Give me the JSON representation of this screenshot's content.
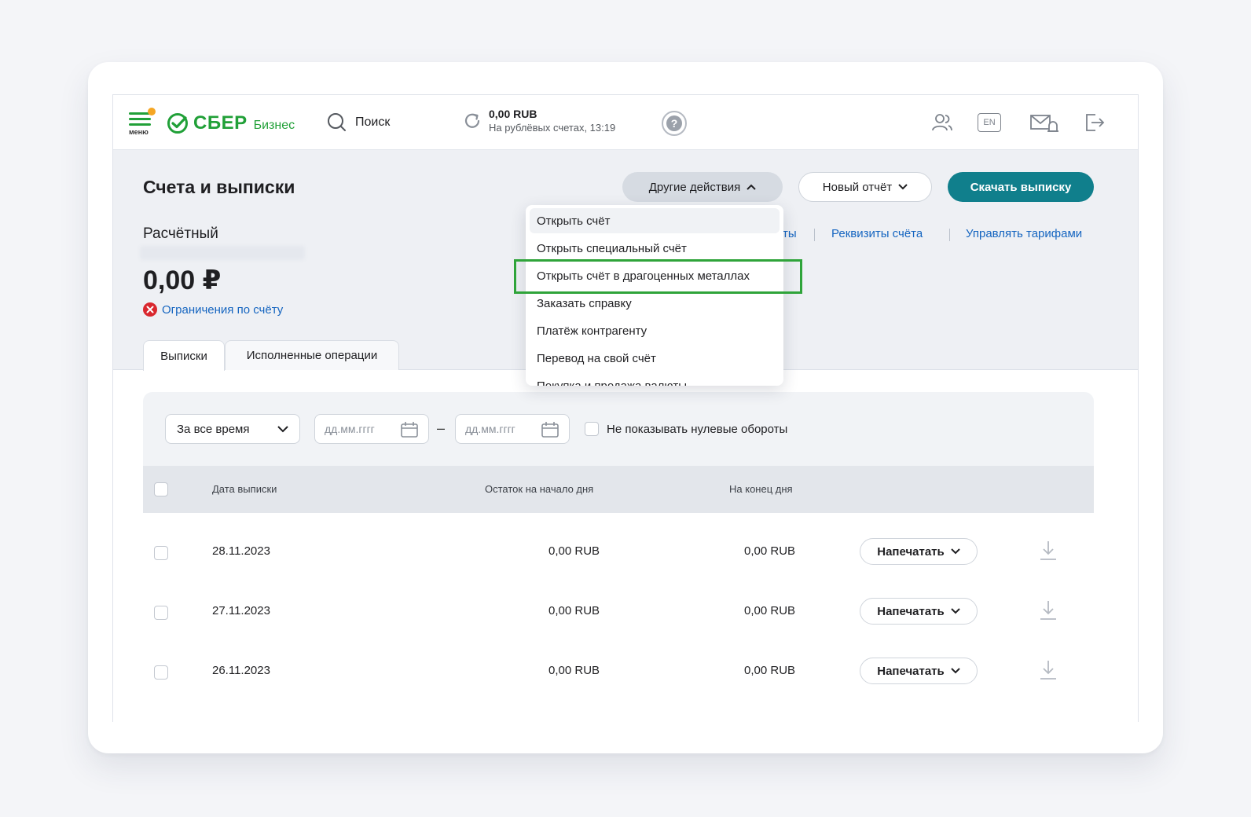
{
  "header": {
    "menu_label": "меню",
    "brand": "СБЕР",
    "brand_sub": "Бизнес",
    "search_label": "Поиск",
    "balance_amount": "0,00 RUB",
    "balance_note": "На рублёвых счетах, 13:19",
    "lang": "EN",
    "icons": [
      "users-icon",
      "lang-icon",
      "mail-bell-icon",
      "logout-icon",
      "help-icon",
      "refresh-icon",
      "search-icon"
    ],
    "colors": {
      "brand": "#21a038",
      "accent": "#107f8c",
      "link": "#1565c0"
    }
  },
  "page": {
    "title": "Счета и выписки",
    "btn_other": "Другие действия",
    "btn_report": "Новый отчёт",
    "btn_download": "Скачать выписку"
  },
  "account": {
    "type": "Расчётный",
    "balance": "0,00 ₽",
    "restrictions": "Ограничения по счёту",
    "link_partial": "ты",
    "link_requisites": "Реквизиты счёта",
    "link_tariffs": "Управлять тарифами"
  },
  "tabs": [
    "Выписки",
    "Исполненные операции"
  ],
  "dropdown": {
    "items": [
      "Открыть счёт",
      "Открыть специальный счёт",
      "Открыть счёт в драгоценных металлах",
      "Заказать справку",
      "Платёж контрагенту",
      "Перевод на свой счёт",
      "Покупка и продажа валюты"
    ],
    "highlighted_index": 2
  },
  "filter": {
    "period": "За все время",
    "date_from_placeholder": "дд.мм.гггг",
    "date_to_placeholder": "дд.мм.гггг",
    "dash": "–",
    "zero_label": "Не показывать нулевые обороты"
  },
  "table": {
    "headers": [
      "Дата выписки",
      "Остаток на начало дня",
      "На конец дня"
    ],
    "rows": [
      {
        "date": "28.11.2023",
        "start": "0,00 RUB",
        "end": "0,00 RUB",
        "action": "Напечатать"
      },
      {
        "date": "27.11.2023",
        "start": "0,00 RUB",
        "end": "0,00 RUB",
        "action": "Напечатать"
      },
      {
        "date": "26.11.2023",
        "start": "0,00 RUB",
        "end": "0,00 RUB",
        "action": "Напечатать"
      }
    ]
  }
}
